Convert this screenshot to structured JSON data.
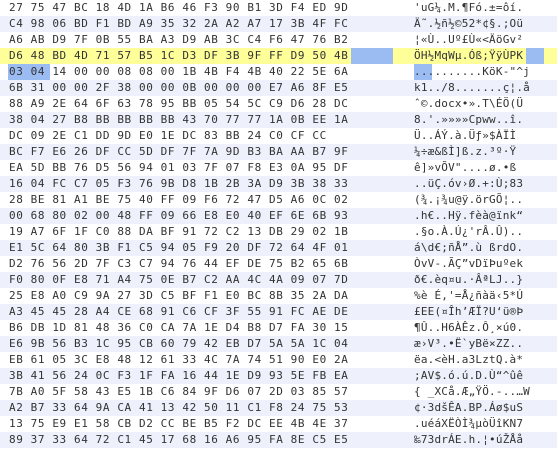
{
  "hex_rows": [
    "27 75 47 BC 18 4D 1A B6 46 F3 90 B1 3D F4 ED 9D",
    "C4 98 06 BD F1 BD A9 35 32 2A A2 A7 17 3B 4F FC",
    "A6 AB D9 7F 0B 55 BA A3 D9 AB 3C C4 F6 47 76 B2",
    "D6 48 BD 4D 71 57 B5 1C D3 DF 3B 9F FF D9 50 4B",
    "03 04 14 00 00 08 08 00 1B 4B F4 4B 40 22 5E 6A",
    "6B 31 00 00 2F 38 00 00 0B 00 00 00 E7 A6 8F E5",
    "88 A9 2E 64 6F 63 78 95 BB 05 54 5C C9 D6 28 DC",
    "38 04 27 B8 BB BB BB BB 43 70 77 77 1A 0B EE 1A",
    "DC 09 2E C1 DD 9D E0 1E DC 83 BB 24 C0 CF CC",
    "BC F7 E6 26 DF CC 5D DF 7F 7A 9D B3 BA AA B7 9F",
    "EA 5D BB 76 D5 56 94 01 03 7F 07 F8 E3 0A 95 DF",
    "16 04 FC C7 05 F3 76 9B D8 1B 2B 3A D9 3B 38 33",
    "28 BE 81 A1 BE 75 40 FF 09 F6 72 47 D5 A6 0C 02",
    "00 68 80 02 00 48 FF 09 66 E8 E0 40 EF 6E 6B 93",
    "19 A7 6F 1F C0 88 DA BF 91 72 C2 13 DB 29 02 1B",
    "E1 5C 64 80 3B F1 C5 94 05 F9 20 DF 72 64 4F 01",
    "D2 76 56 2D 7F C3 C7 94 76 44 EF DE 75 B2 65 6B",
    "F0 80 0F E8 71 A4 75 0E B7 C2 AA 4C 4A 09 07 7D",
    "25 E8 A0 C9 9A 27 3D C5 BF F1 E0 BC 8B 35 2A DA",
    "A3 45 45 28 A4 CE 68 91 C6 CF 3F 55 91 FC AE DE",
    "B6 DB 1D 81 48 36 C0 CA 7A 1E D4 B8 D7 FA 30 15",
    "E6 9B 56 B3 1C 95 CB 60 79 42 EB D7 5A 5A 1C 04",
    "EB 61 05 3C E8 48 12 61 33 4C 7A 74 51 90 E0 2A",
    "3B 41 56 24 0C F3 1F FA 16 44 1E D9 93 5E FB EA",
    "7B A0 5F 58 43 E5 1B C6 84 9F D6 07 2D 03 85 57",
    "A2 B7 33 64 9A CA 41 13 42 50 11 C1 F8 24 75 53",
    "13 75 E9 E1 58 CB D2 CC BE B5 F2 DC EE 4B 4E 37",
    "89 37 33 64 72 C1 45 17 68 16 A6 95 FA 8E C5 E5"
  ],
  "text_rows": [
    "'uG¼.M.¶Fó.±=ôí.",
    "Ä˜.½ñ½©52*¢§.;Oü",
    "¦«Ù..Uº£Ù«<ÄöGv²",
    "ÖH½MqWµ.Óß;ŸÿÙPK",
    "..........KöK-\"^j",
    "k1../8.......ç¦.å",
    "ˆ©.docx•».T\\ÉÖ(Ü",
    "8.'.»»»»Cpww..î.",
    "Ü..ÁÝ.à.Üƒ»$ÀÏÌ",
    "¼÷æ&ßÌ]ß.z.³º·Ÿ",
    "ê]»vÕV\"....ø.•ß",
    "..üÇ.óv›Ø.+:Ù;83",
    "(¾.¡¾u@ÿ.örGÕ¦..",
    ".h€..Hÿ.fèà@ïnk“",
    ".§o.À.Ú¿'rÂ.Û)..",
    "á\\d€;ñÅ”.ù ßrdO.",
    "ÒvV-.ÃÇ”vDïÞuºek",
    "ð€.èq¤u.·ÂªLJ..}",
    "%è É‚'=Å¿ñàä‹5*Ú",
    "£EE(¤ÎhʼÆÏ?U‘ü®Þ",
    "¶Û..H6ÀÊz.Ô¸×ú0.",
    "æ›V³.•Ë`yBë×ZZ..",
    "ëa.<èH.a3LztQ.à*",
    ";AV$.ó.ú.D.Ù“^ûê",
    "{ _XCå.Æ„ŸÖ.-..…W",
    "¢·3dšÊA.BP.Áø$uS",
    ".uéáXËÒÌ¾µòÜîKN7",
    "‰73drÁE.h.¦•úŽÅå"
  ],
  "selection": {
    "highlight_row_index": 3,
    "selected_bytes_row3": "50 4B",
    "selected_bytes_row4": "03 04"
  }
}
